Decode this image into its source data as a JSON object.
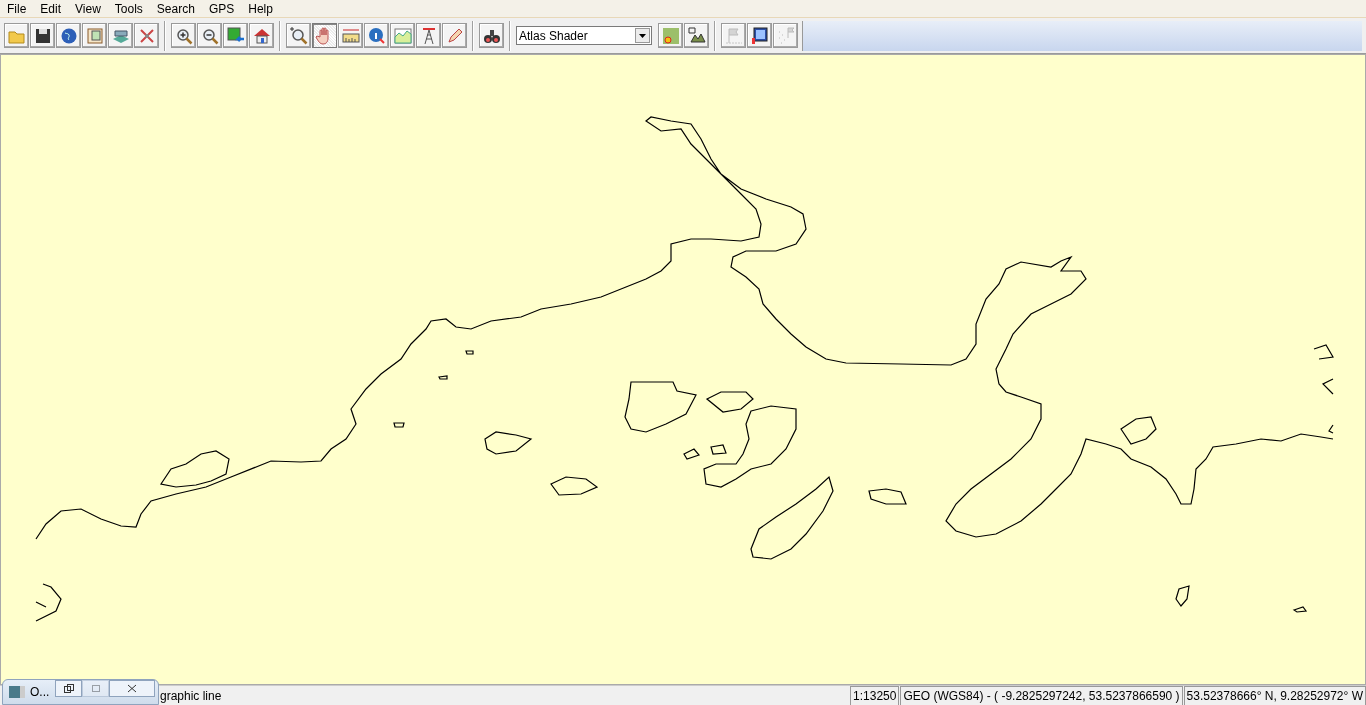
{
  "menu": [
    "File",
    "Edit",
    "View",
    "Tools",
    "Search",
    "GPS",
    "Help"
  ],
  "toolbar": [
    {
      "tools": [
        {
          "kind": "open",
          "selected": false,
          "disabled": false
        },
        {
          "kind": "save",
          "selected": false,
          "disabled": false
        },
        {
          "kind": "globe",
          "selected": false,
          "disabled": false
        },
        {
          "kind": "mapdoc",
          "selected": false,
          "disabled": false
        },
        {
          "kind": "layers",
          "selected": false,
          "disabled": false
        },
        {
          "kind": "tools",
          "selected": false,
          "disabled": false
        }
      ]
    },
    {
      "tools": [
        {
          "kind": "zoomin",
          "selected": false,
          "disabled": false
        },
        {
          "kind": "zoomout",
          "selected": false,
          "disabled": false
        },
        {
          "kind": "extent",
          "selected": false,
          "disabled": false
        },
        {
          "kind": "home",
          "selected": false,
          "disabled": false
        }
      ]
    },
    {
      "tools": [
        {
          "kind": "zoombox",
          "selected": false,
          "disabled": false
        },
        {
          "kind": "pan",
          "selected": true,
          "disabled": false
        },
        {
          "kind": "measure",
          "selected": false,
          "disabled": false
        },
        {
          "kind": "info",
          "selected": false,
          "disabled": false
        },
        {
          "kind": "profile",
          "selected": false,
          "disabled": false
        },
        {
          "kind": "tower",
          "selected": false,
          "disabled": false
        },
        {
          "kind": "pencil",
          "selected": false,
          "disabled": false
        }
      ]
    },
    {
      "tools": [
        {
          "kind": "binoculars",
          "selected": false,
          "disabled": false
        }
      ]
    }
  ],
  "shader": {
    "value": "Atlas Shader",
    "tools": [
      {
        "kind": "shader",
        "selected": false,
        "disabled": false
      },
      {
        "kind": "terrain",
        "selected": false,
        "disabled": false
      }
    ]
  },
  "toolbar_end": [
    {
      "kind": "flag",
      "selected": false,
      "disabled": true
    },
    {
      "kind": "screen",
      "selected": false,
      "disabled": false
    },
    {
      "kind": "stars",
      "selected": false,
      "disabled": true
    }
  ],
  "minimized_window": {
    "title": "O...",
    "buttons": [
      {
        "kind": "restore",
        "disabled": false
      },
      {
        "kind": "maximize",
        "disabled": true
      },
      {
        "kind": "close",
        "disabled": false
      }
    ]
  },
  "status_bar": {
    "message": "graphic line",
    "scale": "1:13250",
    "projection": "GEO (WGS84) - ( -9.2825297242, 53.5237866590 )",
    "latlon": "53.52378666° N, 9.28252972° W"
  }
}
